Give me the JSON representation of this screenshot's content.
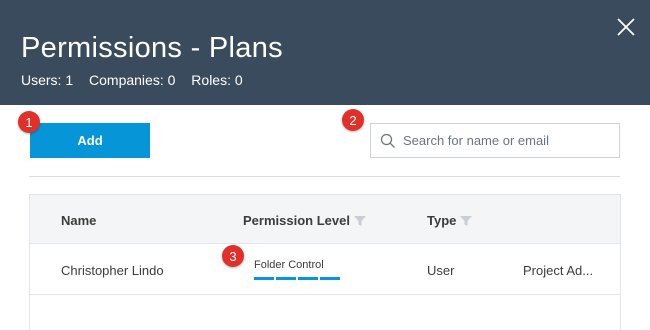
{
  "dialog": {
    "title": "Permissions - Plans",
    "counts": {
      "users": "Users: 1",
      "companies": "Companies: 0",
      "roles": "Roles: 0"
    }
  },
  "toolbar": {
    "add_label": "Add",
    "search_placeholder": "Search for name or email"
  },
  "callouts": [
    "1",
    "2",
    "3"
  ],
  "table": {
    "columns": {
      "name": "Name",
      "permission": "Permission Level",
      "type": "Type"
    },
    "rows": [
      {
        "name": "Christopher Lindo",
        "permission": "Folder Control",
        "permission_level": 4,
        "type": "User",
        "role": "Project Ad..."
      }
    ]
  },
  "colors": {
    "header_bg": "#3b4b5e",
    "accent": "#0696d7",
    "callout": "#e0302a"
  },
  "icons": [
    "close-icon",
    "search-icon",
    "filter-icon"
  ]
}
